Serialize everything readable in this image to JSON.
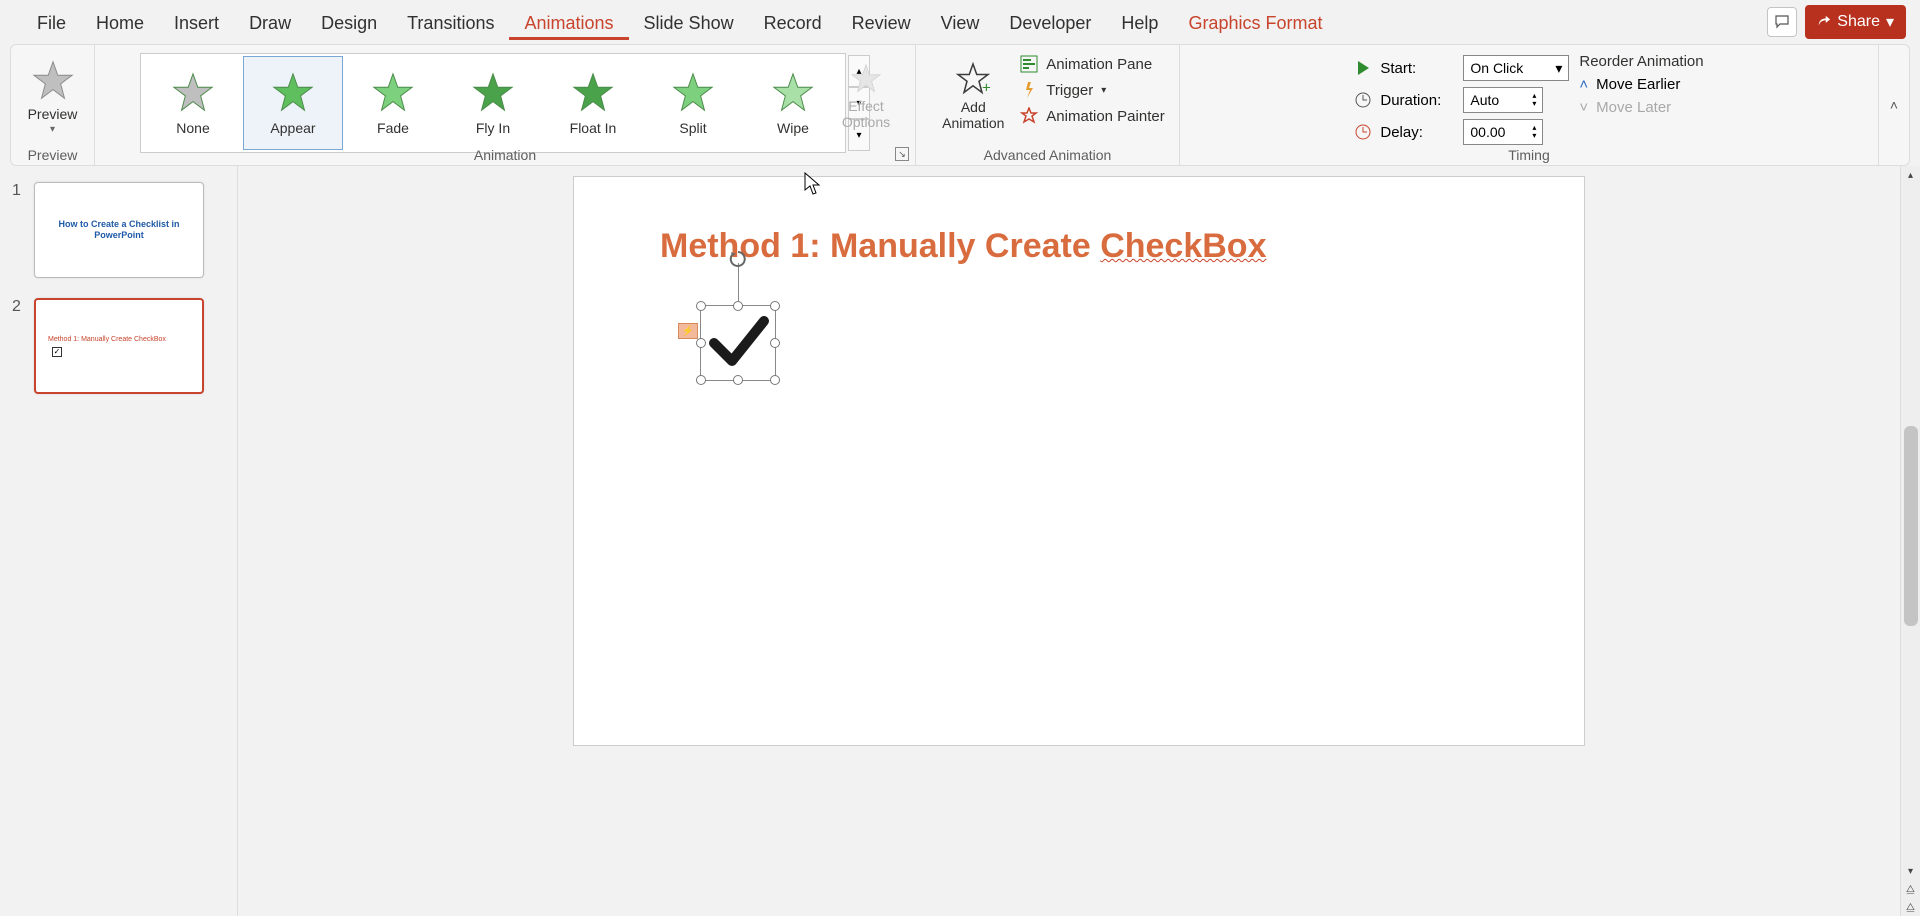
{
  "tabs": {
    "file": "File",
    "home": "Home",
    "insert": "Insert",
    "draw": "Draw",
    "design": "Design",
    "transitions": "Transitions",
    "animations": "Animations",
    "slideshow": "Slide Show",
    "record": "Record",
    "review": "Review",
    "view": "View",
    "developer": "Developer",
    "help": "Help",
    "graphics_format": "Graphics Format"
  },
  "share_label": "Share",
  "preview": {
    "label": "Preview",
    "group": "Preview"
  },
  "animation": {
    "group": "Animation",
    "items": [
      "None",
      "Appear",
      "Fade",
      "Fly In",
      "Float In",
      "Split",
      "Wipe"
    ],
    "selected_index": 1,
    "effect_options": "Effect\nOptions"
  },
  "advanced": {
    "group": "Advanced Animation",
    "add": "Add\nAnimation",
    "pane": "Animation Pane",
    "trigger": "Trigger",
    "painter": "Animation Painter"
  },
  "timing": {
    "group": "Timing",
    "start_label": "Start:",
    "start_value": "On Click",
    "duration_label": "Duration:",
    "duration_value": "Auto",
    "delay_label": "Delay:",
    "delay_value": "00.00",
    "reorder_title": "Reorder Animation",
    "move_earlier": "Move Earlier",
    "move_later": "Move Later"
  },
  "slides": {
    "s1": {
      "num": "1",
      "title": "How to Create a Checklist in PowerPoint"
    },
    "s2": {
      "num": "2",
      "title": "Method 1: Manually Create CheckBox"
    }
  },
  "canvas": {
    "title_prefix": "Method 1: Manually Create ",
    "title_underlined": "CheckBox",
    "anim_tag": "⚡"
  }
}
